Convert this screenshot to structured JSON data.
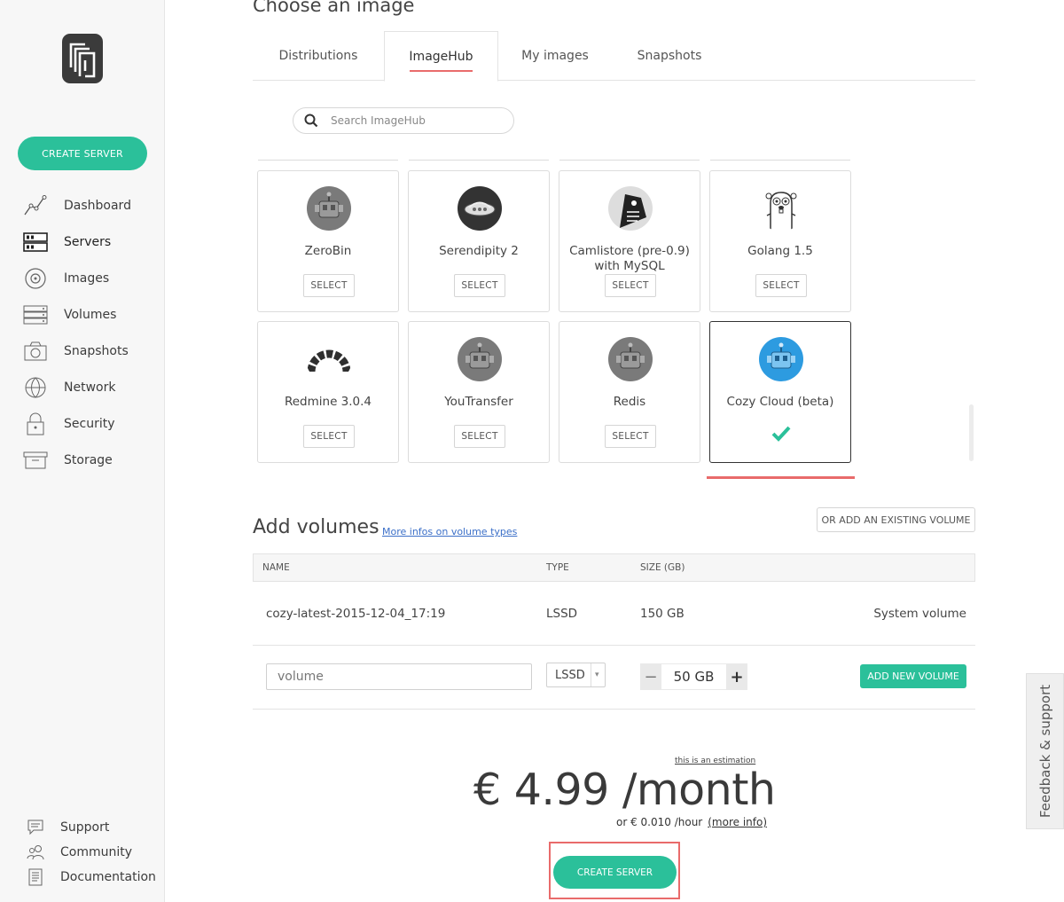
{
  "sidebar": {
    "create_button": "CREATE SERVER",
    "items": [
      {
        "label": "Dashboard",
        "icon": "dashboard-chart-icon"
      },
      {
        "label": "Servers",
        "icon": "servers-icon"
      },
      {
        "label": "Images",
        "icon": "disc-icon"
      },
      {
        "label": "Volumes",
        "icon": "volumes-icon"
      },
      {
        "label": "Snapshots",
        "icon": "camera-icon"
      },
      {
        "label": "Network",
        "icon": "globe-icon"
      },
      {
        "label": "Security",
        "icon": "lock-icon"
      },
      {
        "label": "Storage",
        "icon": "box-icon"
      }
    ],
    "footer": [
      {
        "label": "Support",
        "icon": "chat-icon"
      },
      {
        "label": "Community",
        "icon": "users-icon"
      },
      {
        "label": "Documentation",
        "icon": "document-icon"
      }
    ]
  },
  "choose_image": {
    "title": "Choose an image",
    "tabs": [
      "Distributions",
      "ImageHub",
      "My images",
      "Snapshots"
    ],
    "active_tab": "ImageHub",
    "search_placeholder": "Search ImageHub",
    "select_label": "SELECT",
    "cards": [
      {
        "name": "ZeroBin",
        "icon": "robot-icon"
      },
      {
        "name": "Serendipity 2",
        "icon": "serendipity-icon"
      },
      {
        "name": "Camlistore (pre-0.9) with MySQL",
        "icon": "camlistore-icon"
      },
      {
        "name": "Golang 1.5",
        "icon": "gopher-icon"
      },
      {
        "name": "Redmine 3.0.4",
        "icon": "redmine-icon"
      },
      {
        "name": "YouTransfer",
        "icon": "robot-icon"
      },
      {
        "name": "Redis",
        "icon": "robot-icon"
      },
      {
        "name": "Cozy Cloud (beta)",
        "icon": "cozy-robot-icon",
        "selected": true
      }
    ]
  },
  "volumes": {
    "title": "Add volumes",
    "info_link": "More infos on volume types",
    "add_existing": "OR ADD AN EXISTING VOLUME",
    "columns": [
      "NAME",
      "TYPE",
      "SIZE (GB)"
    ],
    "row": {
      "name": "cozy-latest-2015-12-04_17:19",
      "type": "LSSD",
      "size": "150 GB",
      "note": "System volume"
    },
    "new": {
      "placeholder": "volume",
      "type": "LSSD",
      "size": "50 GB",
      "minus": "−",
      "plus": "+",
      "button": "ADD NEW VOLUME"
    }
  },
  "pricing": {
    "estimation": "this is an estimation",
    "price": "€ 4.99 /month",
    "hourly": "or € 0.010 /hour",
    "more_info": "(more info)",
    "create_button": "CREATE SERVER"
  },
  "feedback": "Feedback & support",
  "colors": {
    "accent": "#2bc09a",
    "highlight": "#e96b6b",
    "link": "#3b6fc8"
  }
}
